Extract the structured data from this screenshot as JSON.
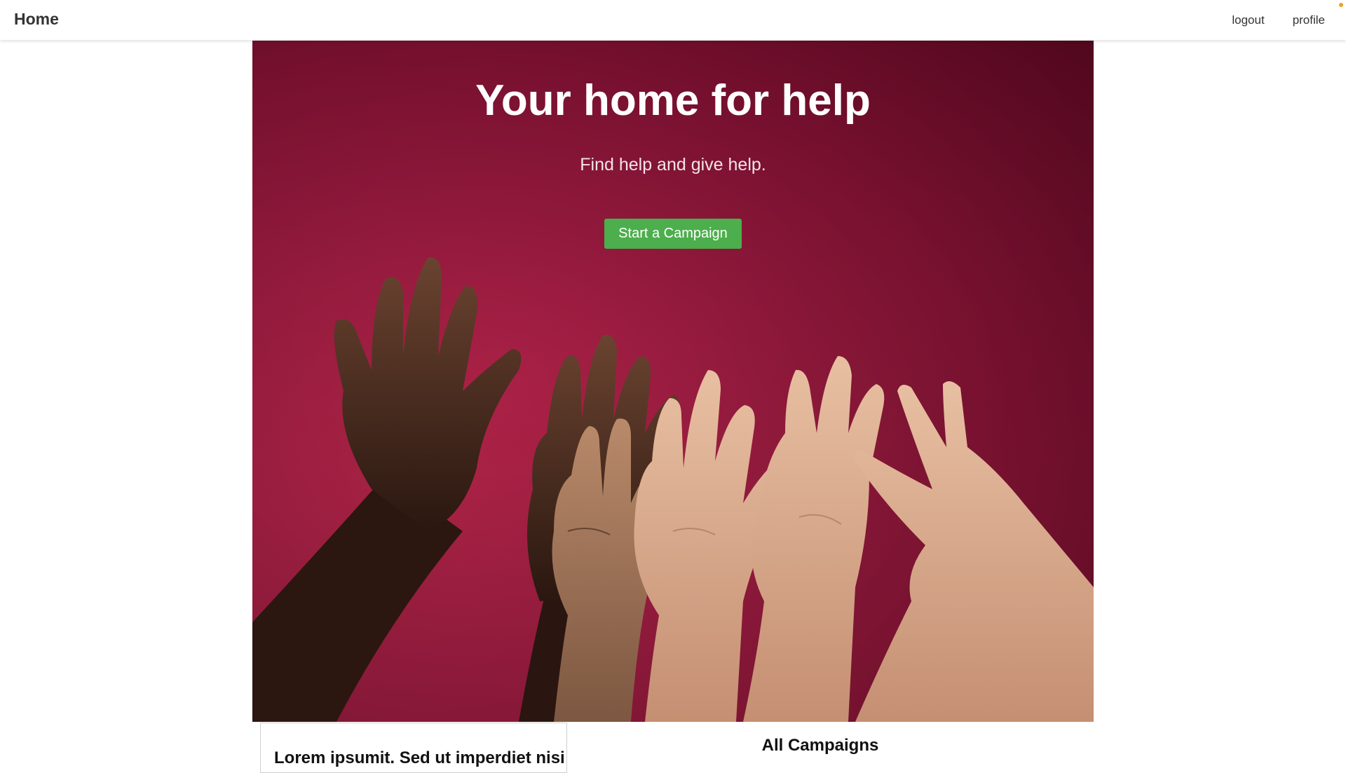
{
  "navbar": {
    "brand": "Home",
    "links": [
      "logout",
      "profile"
    ]
  },
  "hero": {
    "title": "Your home for help",
    "subtitle": "Find help and give help.",
    "cta_label": "Start a Campaign",
    "image": "raised-hands-photo"
  },
  "featured_card": {
    "title": "Lorem ipsumit. Sed ut imperdiet nisi"
  },
  "campaigns": {
    "heading": "All Campaigns"
  },
  "colors": {
    "hero_background": "#a11d43",
    "cta_button": "#4cae4c",
    "notification_dot": "#f0a020",
    "text_dark": "#333333"
  }
}
